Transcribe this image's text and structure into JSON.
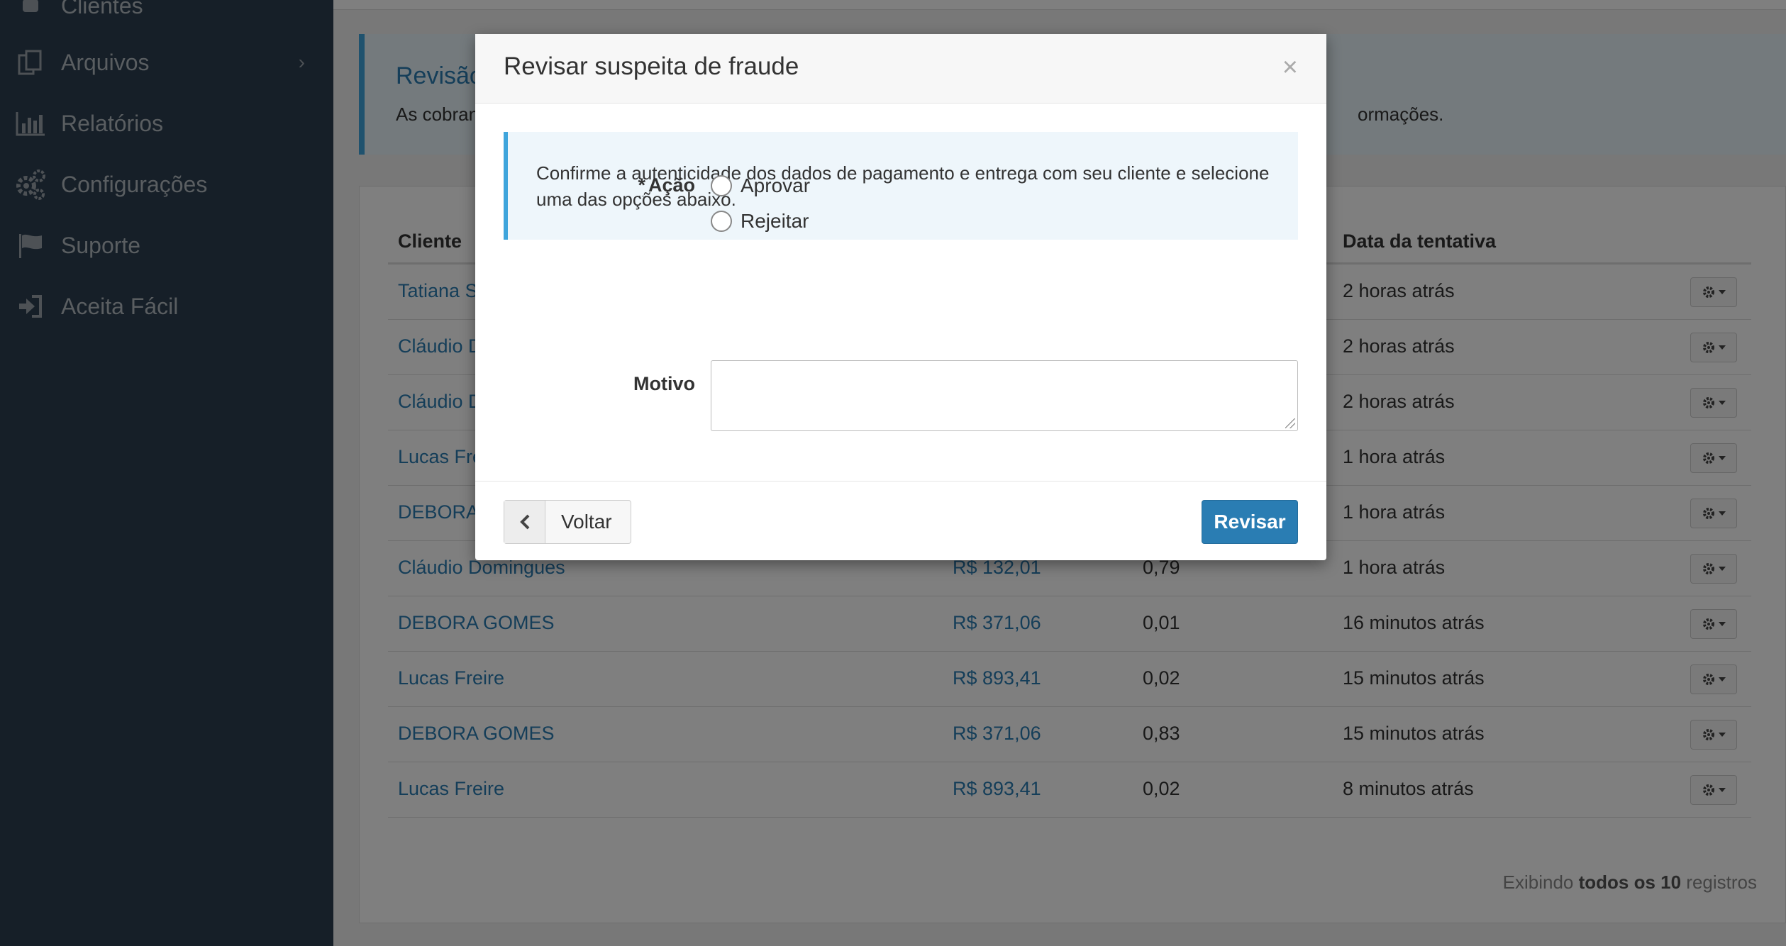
{
  "sidebar": {
    "items": [
      {
        "label": "Clientes",
        "icon": "user-icon"
      },
      {
        "label": "Arquivos",
        "icon": "files-icon"
      },
      {
        "label": "Relatórios",
        "icon": "bar-chart-icon"
      },
      {
        "label": "Configurações",
        "icon": "gears-icon"
      },
      {
        "label": "Suporte",
        "icon": "flag-icon"
      },
      {
        "label": "Aceita Fácil",
        "icon": "sign-in-icon"
      }
    ]
  },
  "page_alert": {
    "title": "Revisão",
    "text_left": "As cobranc",
    "text_right": "ormações."
  },
  "table": {
    "headers": [
      "Cliente",
      "",
      "",
      "Data da tentativa"
    ],
    "rows": [
      {
        "cliente": "Tatiana St",
        "valor": "",
        "score": "",
        "data": "2 horas atrás"
      },
      {
        "cliente": "Cláudio D",
        "valor": "",
        "score": "",
        "data": "2 horas atrás"
      },
      {
        "cliente": "Cláudio D",
        "valor": "",
        "score": "",
        "data": "2 horas atrás"
      },
      {
        "cliente": "Lucas Fre",
        "valor": "",
        "score": "",
        "data": "1 hora atrás"
      },
      {
        "cliente": "DEBORA",
        "valor": "",
        "score": "",
        "data": "1 hora atrás"
      },
      {
        "cliente": "Cláudio Domingues",
        "valor": "R$ 132,01",
        "score": "0,79",
        "data": "1 hora atrás"
      },
      {
        "cliente": "DEBORA GOMES",
        "valor": "R$ 371,06",
        "score": "0,01",
        "data": "16 minutos atrás"
      },
      {
        "cliente": "Lucas Freire",
        "valor": "R$ 893,41",
        "score": "0,02",
        "data": "15 minutos atrás"
      },
      {
        "cliente": "DEBORA GOMES",
        "valor": "R$ 371,06",
        "score": "0,83",
        "data": "15 minutos atrás"
      },
      {
        "cliente": "Lucas Freire",
        "valor": "R$ 893,41",
        "score": "0,02",
        "data": "8 minutos atrás"
      }
    ],
    "footer": {
      "prefix": "Exibindo ",
      "bold": "todos os 10",
      "suffix": " registros"
    }
  },
  "modal": {
    "title": "Revisar suspeita de fraude",
    "close": "×",
    "info": "Confirme a autenticidade dos dados de pagamento e entrega com seu cliente e selecione uma das opções abaixo.",
    "acao_required": "*",
    "acao_label": "Ação",
    "options": [
      "Aprovar",
      "Rejeitar"
    ],
    "motivo_label": "Motivo",
    "motivo_value": "",
    "back_label": "Voltar",
    "submit_label": "Revisar"
  },
  "colors": {
    "sidebar": "#2c3e50",
    "primary": "#2a7db3",
    "info_border": "#3fa5dc"
  }
}
